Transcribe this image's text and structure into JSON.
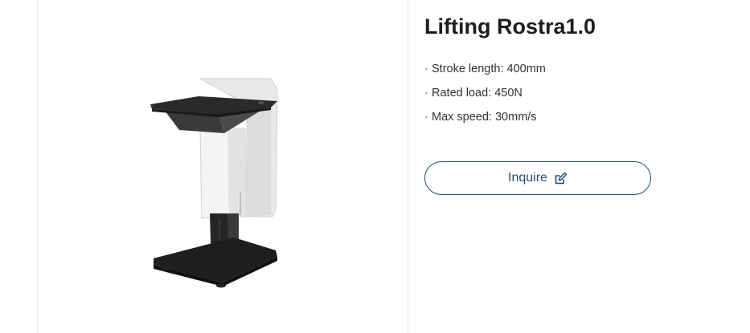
{
  "product": {
    "title": "Lifting Rostra1.0",
    "image_subject": "lifting-rostra-product-photo",
    "specs": [
      {
        "bullet": "·",
        "text": "Stroke length: 400mm"
      },
      {
        "bullet": "·",
        "text": "Rated load: 450N"
      },
      {
        "bullet": "·",
        "text": "Max speed: 30mm/s"
      }
    ]
  },
  "actions": {
    "inquire_label": "Inquire",
    "inquire_icon": "edit-icon"
  },
  "colors": {
    "accent": "#1f4e7a",
    "title": "#1e1e1e",
    "text": "#333333",
    "divider": "#e6e6e6"
  }
}
